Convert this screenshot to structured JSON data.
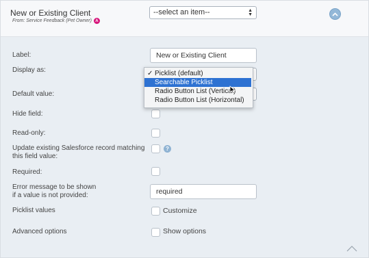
{
  "header": {
    "title": "New or Existing Client",
    "subtitle": "From: Service Feedback (Pet Owner)",
    "badge": "A",
    "select_placeholder": "--select an item--"
  },
  "fields": {
    "label": {
      "label": "Label:",
      "value": "New or Existing Client"
    },
    "display_as": {
      "label": "Display as:",
      "current": "Picklist (default)"
    },
    "default_value": {
      "label": "Default value:"
    },
    "hide_field": {
      "label": "Hide field:"
    },
    "read_only": {
      "label": "Read-only:"
    },
    "update_existing": {
      "label_line1": "Update existing Salesforce record matching",
      "label_line2": "this field value:",
      "help": "?"
    },
    "required": {
      "label": "Required:"
    },
    "error_message": {
      "label_line1": "Error message to be shown",
      "label_line2": "if a value is not provided:",
      "value": "required"
    },
    "picklist_values": {
      "label": "Picklist values",
      "option": "Customize"
    },
    "advanced_options": {
      "label": "Advanced options",
      "option": "Show options"
    }
  },
  "dropdown": {
    "options": [
      {
        "label": "Picklist (default)",
        "checked": true
      },
      {
        "label": "Searchable Picklist",
        "highlighted": true
      },
      {
        "label": "Radio Button List (Vertical)"
      },
      {
        "label": "Radio Button List (Horizontal)"
      }
    ],
    "checkmark": "✓"
  },
  "colors": {
    "highlight": "#2e72d2",
    "badge": "#d6147a",
    "collapse": "#93b8d8"
  },
  "icons": [
    "chevron-up-icon",
    "help-icon",
    "select-arrows-icon",
    "mouse-cursor-icon"
  ]
}
